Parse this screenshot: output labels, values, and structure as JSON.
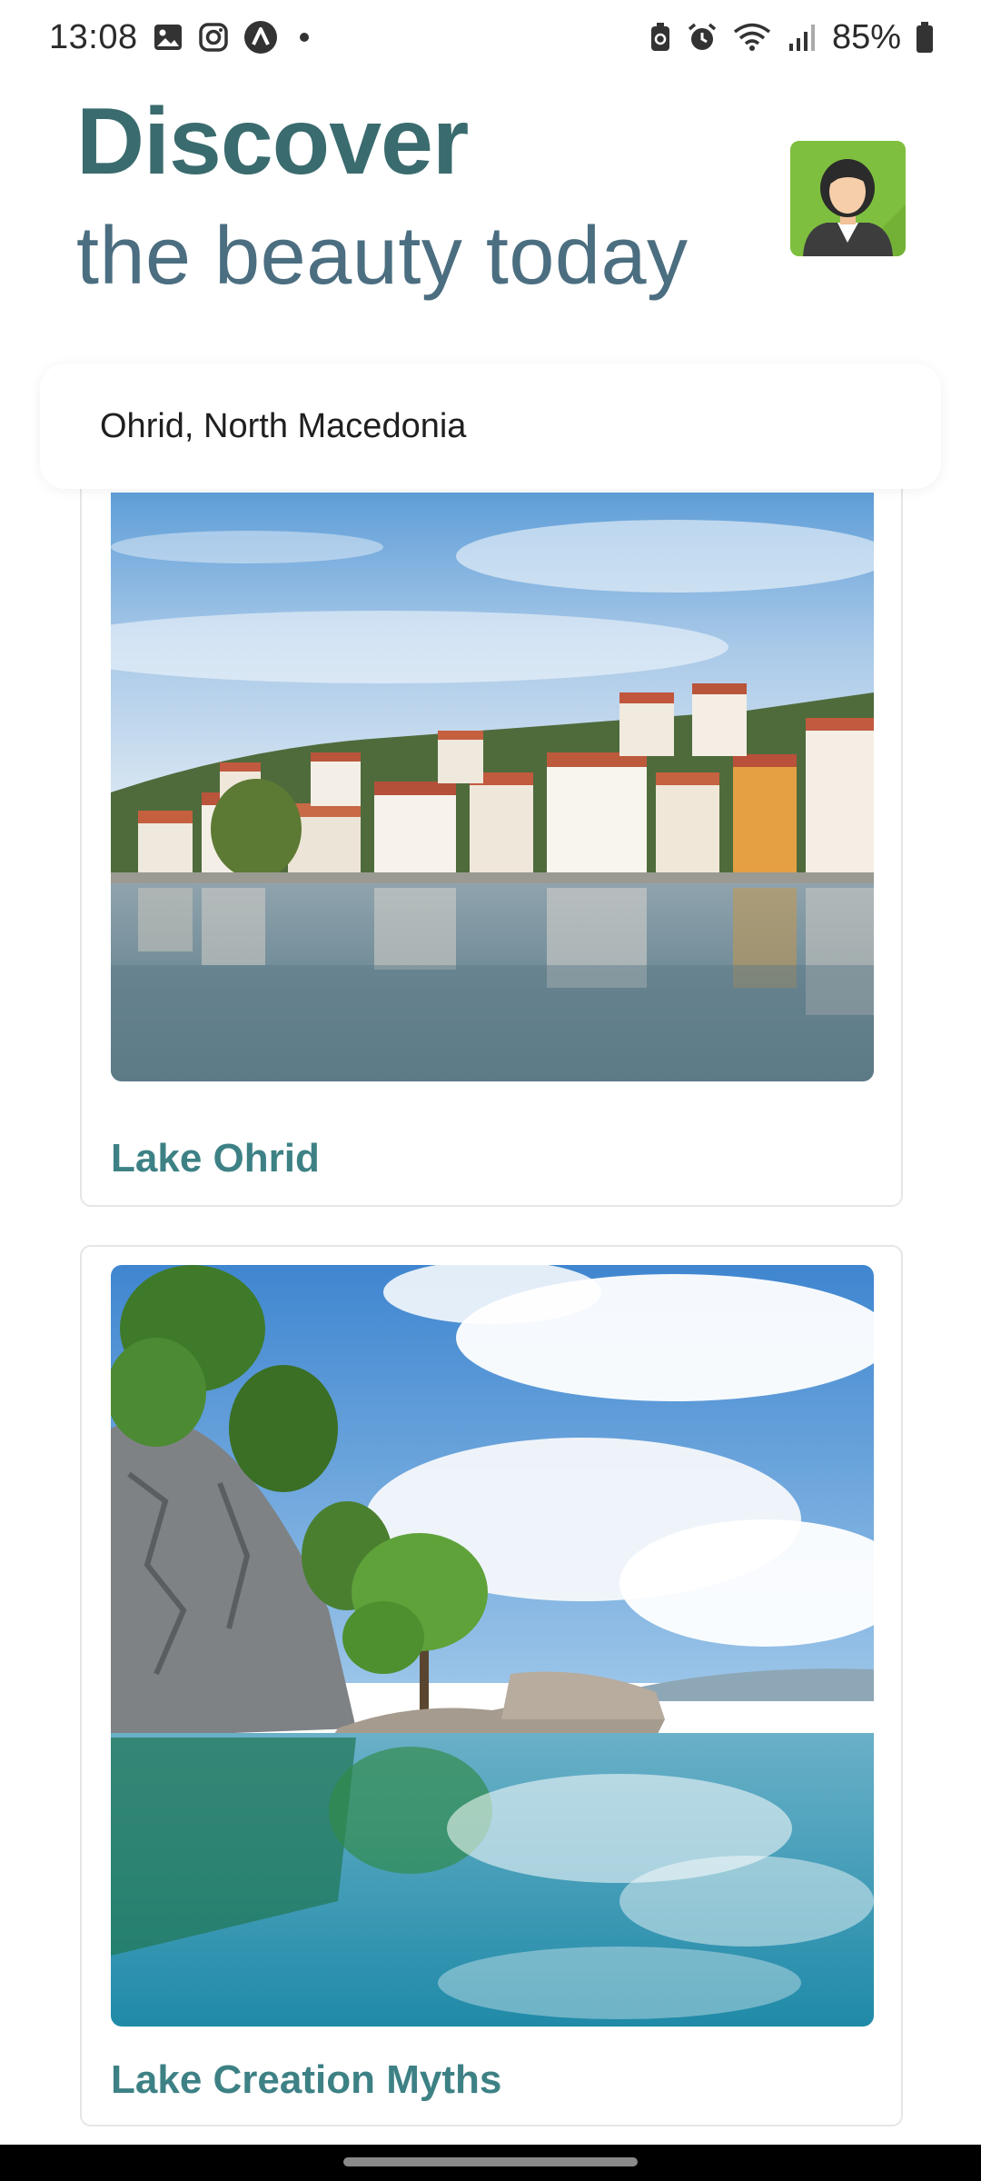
{
  "status_bar": {
    "time": "13:08",
    "battery": "85%",
    "left_icons": [
      "gallery-icon",
      "instagram-icon",
      "app-icon",
      "dot-icon"
    ],
    "right_icons": [
      "battery-saver-icon",
      "alarm-icon",
      "wifi-icon",
      "signal-icon",
      "battery-icon"
    ]
  },
  "header": {
    "title": "Discover",
    "subtitle": "the beauty today"
  },
  "avatar": {
    "icon": "user-avatar-icon",
    "background_color": "#7fbf3f"
  },
  "search": {
    "value": "Ohrid, North Macedonia"
  },
  "cards": [
    {
      "title": "Lake Ohrid",
      "image": "lake-ohrid-town-photo"
    },
    {
      "title": "Lake Creation Myths",
      "image": "lake-cliff-tree-photo"
    }
  ],
  "colors": {
    "title": "#3a6b6e",
    "subtitle": "#4b6e80",
    "card_title": "#3d8185"
  }
}
